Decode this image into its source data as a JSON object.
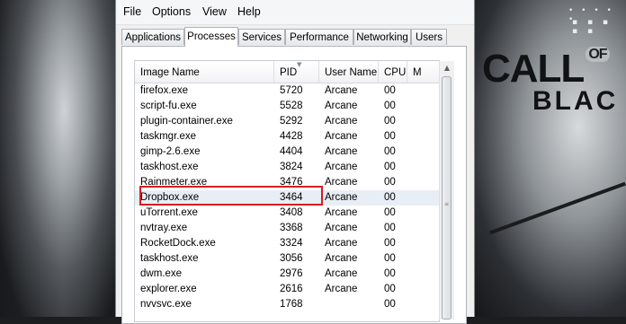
{
  "menu": [
    "File",
    "Options",
    "View",
    "Help"
  ],
  "tabs": [
    "Applications",
    "Processes",
    "Services",
    "Performance",
    "Networking",
    "Users"
  ],
  "active_tab": "Processes",
  "columns": [
    "Image Name",
    "PID",
    "User Name",
    "CPU",
    "M"
  ],
  "processes": [
    {
      "name": "firefox.exe",
      "pid": "5720",
      "user": "Arcane",
      "cpu": "00"
    },
    {
      "name": "script-fu.exe",
      "pid": "5528",
      "user": "Arcane",
      "cpu": "00"
    },
    {
      "name": "plugin-container.exe",
      "pid": "5292",
      "user": "Arcane",
      "cpu": "00"
    },
    {
      "name": "taskmgr.exe",
      "pid": "4428",
      "user": "Arcane",
      "cpu": "00"
    },
    {
      "name": "gimp-2.6.exe",
      "pid": "4404",
      "user": "Arcane",
      "cpu": "00"
    },
    {
      "name": "taskhost.exe",
      "pid": "3824",
      "user": "Arcane",
      "cpu": "00"
    },
    {
      "name": "Rainmeter.exe",
      "pid": "3476",
      "user": "Arcane",
      "cpu": "00"
    },
    {
      "name": "Dropbox.exe",
      "pid": "3464",
      "user": "Arcane",
      "cpu": "00"
    },
    {
      "name": "uTorrent.exe",
      "pid": "3408",
      "user": "Arcane",
      "cpu": "00"
    },
    {
      "name": "nvtray.exe",
      "pid": "3368",
      "user": "Arcane",
      "cpu": "00"
    },
    {
      "name": "RocketDock.exe",
      "pid": "3324",
      "user": "Arcane",
      "cpu": "00"
    },
    {
      "name": "taskhost.exe",
      "pid": "3056",
      "user": "Arcane",
      "cpu": "00"
    },
    {
      "name": "dwm.exe",
      "pid": "2976",
      "user": "Arcane",
      "cpu": "00"
    },
    {
      "name": "explorer.exe",
      "pid": "2616",
      "user": "Arcane",
      "cpu": "00"
    },
    {
      "name": "nvvsvc.exe",
      "pid": "1768",
      "user": "",
      "cpu": "00"
    }
  ],
  "selected_process": "Dropbox.exe",
  "wallpaper": {
    "logo_line1": "CALL",
    "logo_of": "OF",
    "logo_line2": "BLAC"
  },
  "colors": {
    "highlight_box": "#d21f1f",
    "selection": "#e8eef6"
  }
}
